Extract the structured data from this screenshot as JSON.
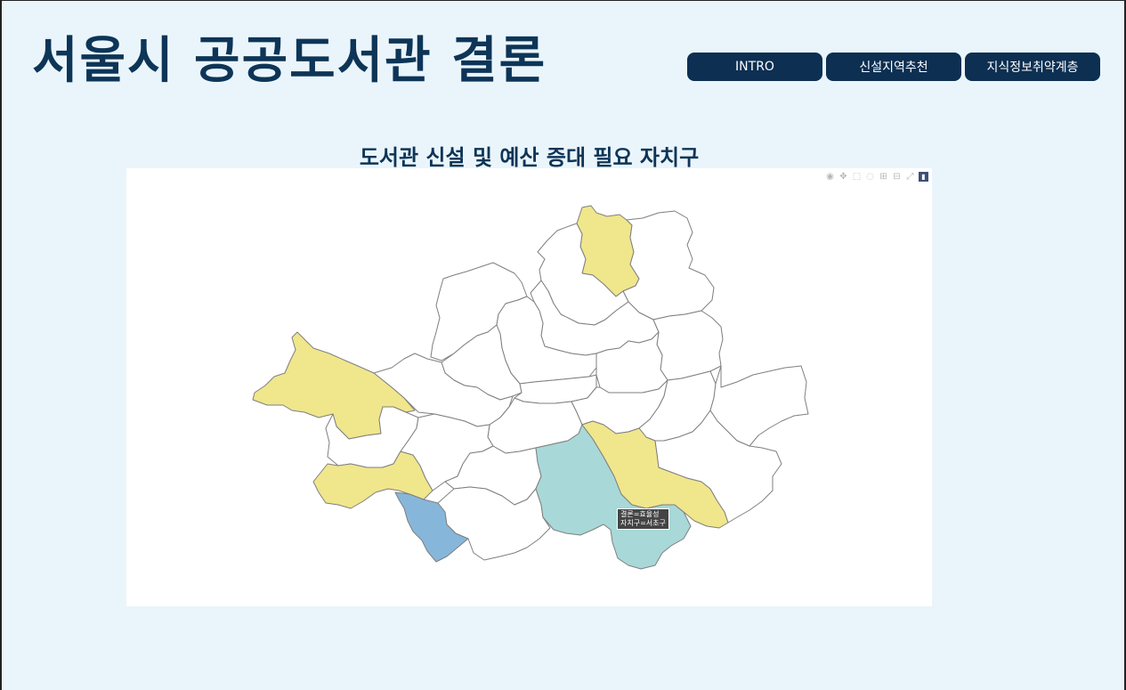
{
  "page": {
    "title": "서울시 공공도서관 결론"
  },
  "nav": {
    "intro": "INTRO",
    "recommend": "신설지역추천",
    "vulnerable": "지식정보취약계층"
  },
  "map": {
    "title": "도서관 신설 및 예산 증대 필요 자치구",
    "colors": {
      "yellow": "#f0e68c",
      "teal": "#a8d8d8",
      "blue": "#86b7db",
      "white": "#ffffff"
    },
    "tooltip": {
      "line1": "결론=효율성",
      "line2": "자치구=서초구"
    }
  },
  "modebar": [
    "camera-icon",
    "pan-icon",
    "box-select-icon",
    "lasso-icon",
    "zoom-in-icon",
    "zoom-out-icon",
    "autoscale-icon",
    "plotly-logo"
  ]
}
